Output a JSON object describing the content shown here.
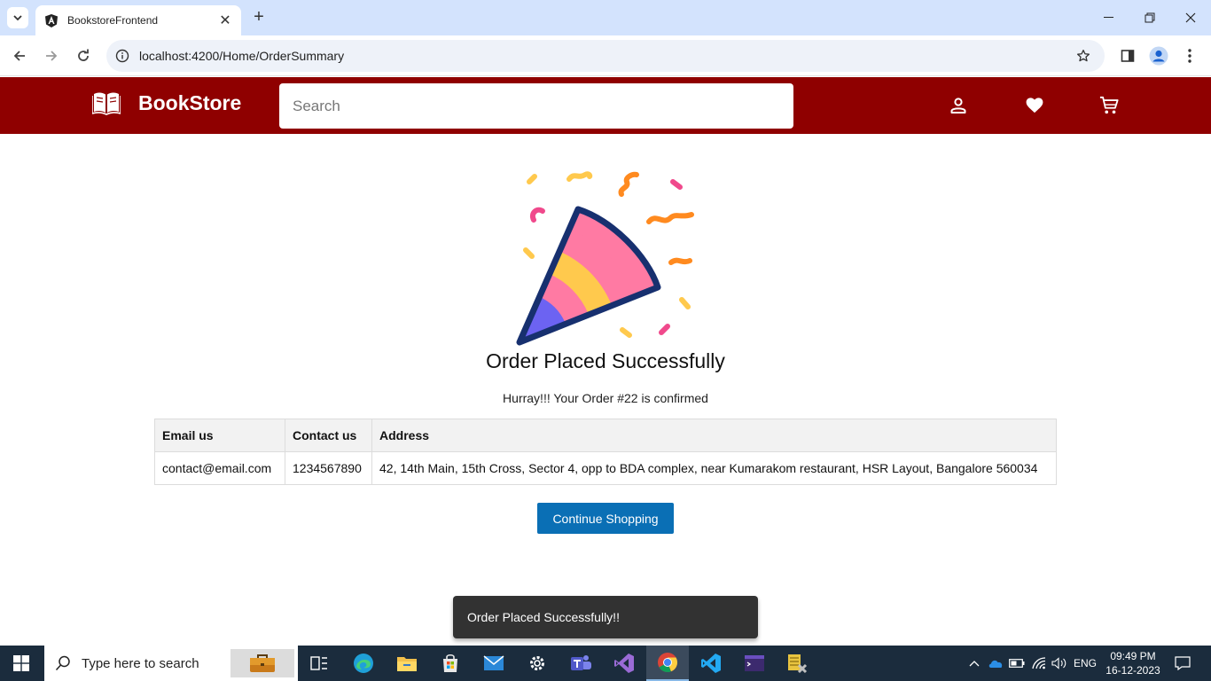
{
  "browser": {
    "tab_title": "BookstoreFrontend",
    "url": "localhost:4200/Home/OrderSummary"
  },
  "header": {
    "brand": "BookStore",
    "search_placeholder": "Search",
    "icons": [
      "profile-icon",
      "wishlist-heart-icon",
      "cart-icon"
    ]
  },
  "main": {
    "title": "Order Placed Successfully",
    "subtitle": "Hurray!!! Your Order #22 is confirmed",
    "table": {
      "headers": [
        "Email us",
        "Contact us",
        "Address"
      ],
      "row": [
        "contact@email.com",
        "1234567890",
        "42, 14th Main, 15th Cross, Sector 4, opp to BDA complex, near Kumarakom restaurant, HSR Layout, Bangalore 560034"
      ]
    },
    "continue_label": "Continue Shopping"
  },
  "snackbar": {
    "message": "Order Placed Successfully!!"
  },
  "taskbar": {
    "search_placeholder": "Type here to search",
    "language": "ENG",
    "time": "09:49 PM",
    "date": "16-12-2023"
  },
  "colors": {
    "header_bg": "#8f0000",
    "button_bg": "#0a6fb5",
    "snackbar_bg": "#323232"
  }
}
